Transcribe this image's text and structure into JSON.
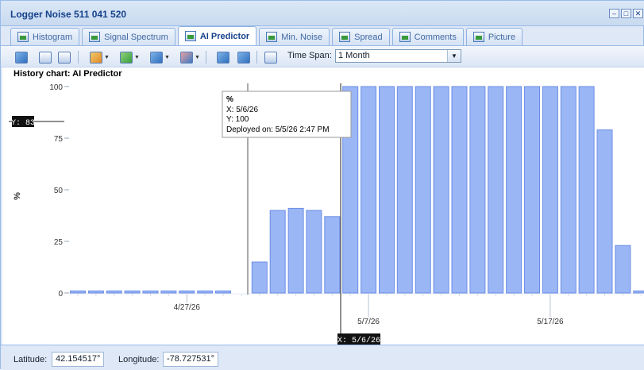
{
  "window": {
    "title": "Logger Noise 511 041 520"
  },
  "tabs": [
    {
      "label": "Histogram",
      "icon": "bar-chart-icon",
      "active": false
    },
    {
      "label": "Signal Spectrum",
      "icon": "spectrum-icon",
      "active": false
    },
    {
      "label": "AI Predictor",
      "icon": "line-chart-icon",
      "active": true
    },
    {
      "label": "Min. Noise",
      "icon": "line-chart-icon",
      "active": false
    },
    {
      "label": "Spread",
      "icon": "line-chart-icon",
      "active": false
    },
    {
      "label": "Comments",
      "icon": "document-icon",
      "active": false
    },
    {
      "label": "Picture",
      "icon": "image-icon",
      "active": false
    }
  ],
  "toolbar": {
    "time_span_label": "Time Span:",
    "time_span_value": "1 Month"
  },
  "chart_heading": "History chart: AI Predictor",
  "chart_data": {
    "type": "bar",
    "ylabel": "%",
    "ylim": [
      0,
      100
    ],
    "yticks": [
      0,
      25,
      50,
      75,
      100
    ],
    "xtick_labels": [
      "4/27/26",
      "5/7/26",
      "5/17/26"
    ],
    "x": [
      "4/21/26",
      "4/22/26",
      "4/23/26",
      "4/24/26",
      "4/25/26",
      "4/26/26",
      "4/27/26",
      "4/28/26",
      "4/29/26",
      "4/30/26",
      "5/1/26",
      "5/2/26",
      "5/3/26",
      "5/4/26",
      "5/5/26",
      "5/6/26",
      "5/7/26",
      "5/8/26",
      "5/9/26",
      "5/10/26",
      "5/11/26",
      "5/12/26",
      "5/13/26",
      "5/14/26",
      "5/15/26",
      "5/16/26",
      "5/17/26",
      "5/18/26",
      "5/19/26",
      "5/20/26",
      "5/21/26",
      "5/22/26"
    ],
    "values": [
      1,
      1,
      1,
      1,
      1,
      1,
      1,
      1,
      1,
      null,
      15,
      40,
      41,
      40,
      37,
      100,
      100,
      100,
      100,
      100,
      100,
      100,
      100,
      100,
      100,
      100,
      100,
      100,
      100,
      79,
      23,
      1
    ],
    "crosshair": {
      "x_label": "X: 5/6/26",
      "y_label": "Y: 83"
    },
    "tooltip": {
      "title": "%",
      "x": "X: 5/6/26",
      "y": "Y: 100",
      "deployed": "Deployed on: 5/5/26 2:47 PM"
    },
    "colors": {
      "bar_fill": "#9bb6f5",
      "bar_stroke": "#6a8ee6"
    }
  },
  "status": {
    "latitude_label": "Latitude:",
    "latitude_value": "42.154517°",
    "longitude_label": "Longitude:",
    "longitude_value": "-78.727531°"
  }
}
